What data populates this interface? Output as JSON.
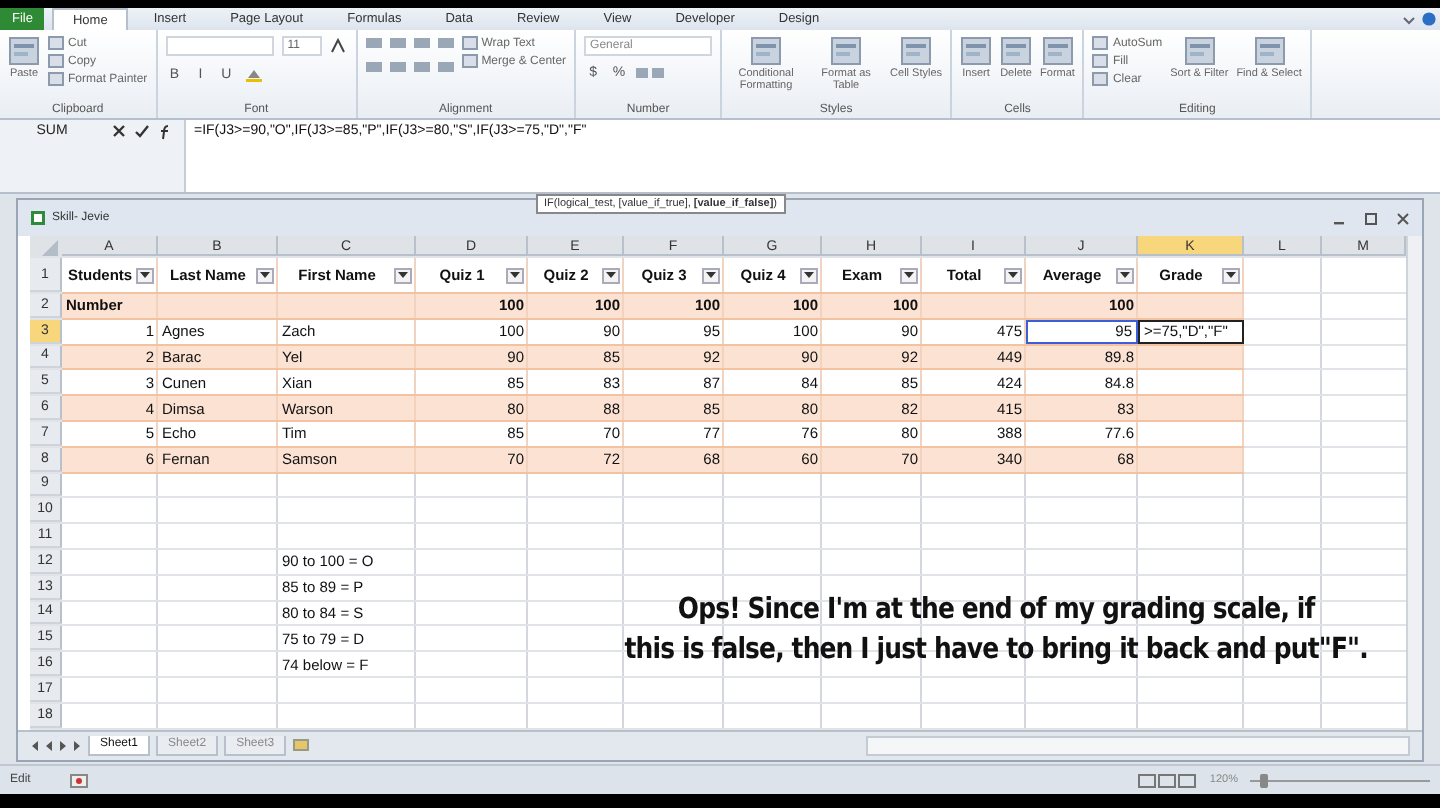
{
  "ribbon_tabs": [
    {
      "label": "File",
      "selected": false,
      "kind": "file"
    },
    {
      "label": "Home",
      "selected": true,
      "kind": "tab"
    },
    {
      "label": "Insert",
      "selected": false,
      "kind": "tab"
    },
    {
      "label": "Page Layout",
      "selected": false,
      "kind": "tab"
    },
    {
      "label": "Formulas",
      "selected": false,
      "kind": "tab"
    },
    {
      "label": "Data",
      "selected": false,
      "kind": "tab"
    },
    {
      "label": "Review",
      "selected": false,
      "kind": "tab"
    },
    {
      "label": "View",
      "selected": false,
      "kind": "tab"
    },
    {
      "label": "Developer",
      "selected": false,
      "kind": "tab"
    },
    {
      "label": "Design",
      "selected": false,
      "kind": "tab"
    }
  ],
  "ribbon": {
    "groups": [
      {
        "label": "Clipboard",
        "kind": "generic",
        "items": [
          {
            "label": "Paste",
            "kind": "large"
          },
          {
            "label": "Cut",
            "kind": "small"
          },
          {
            "label": "Copy",
            "kind": "small"
          },
          {
            "label": "Format Painter",
            "kind": "small"
          }
        ]
      },
      {
        "label": "Font",
        "kind": "font",
        "font_size": "11",
        "items": [
          {
            "label": "B",
            "kind": "bold"
          },
          {
            "label": "I",
            "kind": "italic"
          },
          {
            "label": "U",
            "kind": "underline"
          }
        ]
      },
      {
        "label": "Alignment",
        "kind": "generic",
        "items": [
          {
            "label": "Wrap Text",
            "kind": "small"
          },
          {
            "label": "Merge & Center",
            "kind": "small"
          }
        ]
      },
      {
        "label": "Number",
        "kind": "number",
        "format": "General",
        "items": [
          {
            "label": "$",
            "kind": "currency"
          },
          {
            "label": "%",
            "kind": "percent"
          }
        ]
      },
      {
        "label": "Styles",
        "kind": "generic",
        "items": [
          {
            "label": "Conditional Formatting",
            "kind": "large"
          },
          {
            "label": "Format as Table",
            "kind": "large"
          },
          {
            "label": "Cell Styles",
            "kind": "large"
          }
        ]
      },
      {
        "label": "Cells",
        "kind": "generic",
        "items": [
          {
            "label": "Insert",
            "kind": "large"
          },
          {
            "label": "Delete",
            "kind": "large"
          },
          {
            "label": "Format",
            "kind": "large"
          }
        ]
      },
      {
        "label": "Editing",
        "kind": "generic",
        "items": [
          {
            "label": "AutoSum",
            "kind": "small"
          },
          {
            "label": "Fill",
            "kind": "small"
          },
          {
            "label": "Clear",
            "kind": "small"
          },
          {
            "label": "Sort & Filter",
            "kind": "large"
          },
          {
            "label": "Find & Select",
            "kind": "large"
          }
        ]
      }
    ]
  },
  "formula_bar": {
    "name_box": "SUM",
    "formula": "=IF(J3>=90,\"O\",IF(J3>=85,\"P\",IF(J3>=80,\"S\",IF(J3>=75,\"D\",\"F\"",
    "tooltip": "IF(logical_test, [value_if_true], **[value_if_false]**)"
  },
  "workbook": {
    "title": "Skill- Jevie",
    "columns": [
      {
        "label": "A",
        "selected": false
      },
      {
        "label": "B",
        "selected": false
      },
      {
        "label": "C",
        "selected": false
      },
      {
        "label": "D",
        "selected": false
      },
      {
        "label": "E",
        "selected": false
      },
      {
        "label": "F",
        "selected": false
      },
      {
        "label": "G",
        "selected": false
      },
      {
        "label": "H",
        "selected": false
      },
      {
        "label": "I",
        "selected": false
      },
      {
        "label": "J",
        "selected": false
      },
      {
        "label": "K",
        "selected": true
      },
      {
        "label": "L",
        "selected": false
      },
      {
        "label": "M",
        "selected": false
      }
    ],
    "rows": [
      {
        "number": "1",
        "selected": false,
        "kind": "header",
        "cells": {
          "A": "Students",
          "B": "Last Name",
          "C": "First Name",
          "D": "Quiz 1",
          "E": "Quiz 2",
          "F": "Quiz 3",
          "G": "Quiz 4",
          "H": "Exam",
          "I": "Total",
          "J": "Average",
          "K": "Grade"
        }
      },
      {
        "number": "2",
        "selected": false,
        "kind": "table",
        "bold": true,
        "cells": {
          "A": "Number",
          "D": "100",
          "E": "100",
          "F": "100",
          "G": "100",
          "H": "100",
          "J": "100"
        }
      },
      {
        "number": "3",
        "selected": true,
        "kind": "table",
        "cells": {
          "A": "1",
          "B": "Agnes",
          "C": "Zach",
          "D": "100",
          "E": "90",
          "F": "95",
          "G": "100",
          "H": "90",
          "I": "475",
          "J": {
            "text": "95",
            "referenced": true,
            "active": false
          },
          "K": {
            "text": ">=75,\"D\",\"F\"",
            "active": true,
            "referenced": false
          }
        }
      },
      {
        "number": "4",
        "selected": false,
        "kind": "table",
        "cells": {
          "A": "2",
          "B": "Barac",
          "C": "Yel",
          "D": "90",
          "E": "85",
          "F": "92",
          "G": "90",
          "H": "92",
          "I": "449",
          "J": "89.8"
        }
      },
      {
        "number": "5",
        "selected": false,
        "kind": "table",
        "cells": {
          "A": "3",
          "B": "Cunen",
          "C": "Xian",
          "D": "85",
          "E": "83",
          "F": "87",
          "G": "84",
          "H": "85",
          "I": "424",
          "J": "84.8"
        }
      },
      {
        "number": "6",
        "selected": false,
        "kind": "table",
        "cells": {
          "A": "4",
          "B": "Dimsa",
          "C": "Warson",
          "D": "80",
          "E": "88",
          "F": "85",
          "G": "80",
          "H": "82",
          "I": "415",
          "J": "83"
        }
      },
      {
        "number": "7",
        "selected": false,
        "kind": "table",
        "cells": {
          "A": "5",
          "B": "Echo",
          "C": "Tim",
          "D": "85",
          "E": "70",
          "F": "77",
          "G": "76",
          "H": "80",
          "I": "388",
          "J": "77.6"
        }
      },
      {
        "number": "8",
        "selected": false,
        "kind": "table",
        "cells": {
          "A": "6",
          "B": "Fernan",
          "C": "Samson",
          "D": "70",
          "E": "72",
          "F": "68",
          "G": "60",
          "H": "70",
          "I": "340",
          "J": "68"
        }
      },
      {
        "number": "9",
        "selected": false,
        "kind": "plain",
        "cells": {}
      },
      {
        "number": "10",
        "selected": false,
        "kind": "plain",
        "cells": {}
      },
      {
        "number": "11",
        "selected": false,
        "kind": "plain",
        "cells": {}
      },
      {
        "number": "12",
        "selected": false,
        "kind": "plain",
        "cells": {
          "C": "90 to 100 = O"
        }
      },
      {
        "number": "13",
        "selected": false,
        "kind": "plain",
        "cells": {
          "C": "85 to 89 = P"
        }
      },
      {
        "number": "14",
        "selected": false,
        "kind": "plain",
        "cells": {
          "C": "80 to 84 = S"
        }
      },
      {
        "number": "15",
        "selected": false,
        "kind": "plain",
        "cells": {
          "C": "75 to 79 = D"
        }
      },
      {
        "number": "16",
        "selected": false,
        "kind": "plain",
        "cells": {
          "C": "74 below = F"
        }
      },
      {
        "number": "17",
        "selected": false,
        "kind": "plain",
        "cells": {}
      },
      {
        "number": "18",
        "selected": false,
        "kind": "plain",
        "cells": {}
      }
    ],
    "sheet_tabs": [
      {
        "label": "Sheet1",
        "selected": true
      },
      {
        "label": "Sheet2",
        "selected": false
      },
      {
        "label": "Sheet3",
        "selected": false
      }
    ]
  },
  "caption": [
    "Ops! Since I'm at the end of my grading scale, if",
    "this is false, then I just have to bring it back and put\"F\"."
  ],
  "status_bar": {
    "mode": "Edit",
    "zoom": "120%",
    "zoom_slider": {
      "level": 0.06
    }
  }
}
